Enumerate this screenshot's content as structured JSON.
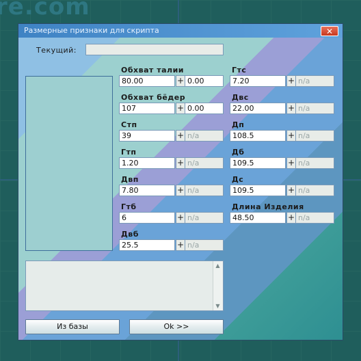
{
  "background": {
    "watermark": "re.com"
  },
  "dialog": {
    "title": "Размерные признаки для скрипта",
    "close_symbol": "✕",
    "current_label": "Текущий:",
    "current_value": "",
    "left_column": [
      {
        "label": "Обхват талии",
        "value": "80.00",
        "extra": "0.00",
        "extra_muted": false
      },
      {
        "label": "Обхват бёдер",
        "value": "107",
        "extra": "0.00",
        "extra_muted": false
      },
      {
        "label": "Стп",
        "value": "39",
        "extra": "n/a",
        "extra_muted": true
      },
      {
        "label": "Гтп",
        "value": "1.20",
        "extra": "n/a",
        "extra_muted": true
      },
      {
        "label": "Двп",
        "value": "7.80",
        "extra": "n/a",
        "extra_muted": true
      },
      {
        "label": "Гтб",
        "value": "6",
        "extra": "n/a",
        "extra_muted": true
      },
      {
        "label": "Двб",
        "value": "25.5",
        "extra": "n/a",
        "extra_muted": true
      }
    ],
    "right_column": [
      {
        "label": "Гтс",
        "value": "7.20",
        "extra": "n/a",
        "extra_muted": true
      },
      {
        "label": "Двс",
        "value": "22.00",
        "extra": "n/a",
        "extra_muted": true
      },
      {
        "label": "Дп",
        "value": "108.5",
        "extra": "n/a",
        "extra_muted": true
      },
      {
        "label": "Дб",
        "value": "109.5",
        "extra": "n/a",
        "extra_muted": true
      },
      {
        "label": "Дс",
        "value": "109.5",
        "extra": "n/a",
        "extra_muted": true
      },
      {
        "label": "Длина Изделия",
        "value": "48.50",
        "extra": "n/a",
        "extra_muted": true
      }
    ],
    "plus_symbol": "+",
    "buttons": {
      "from_base": "Из базы",
      "ok": "Ok >>"
    }
  }
}
